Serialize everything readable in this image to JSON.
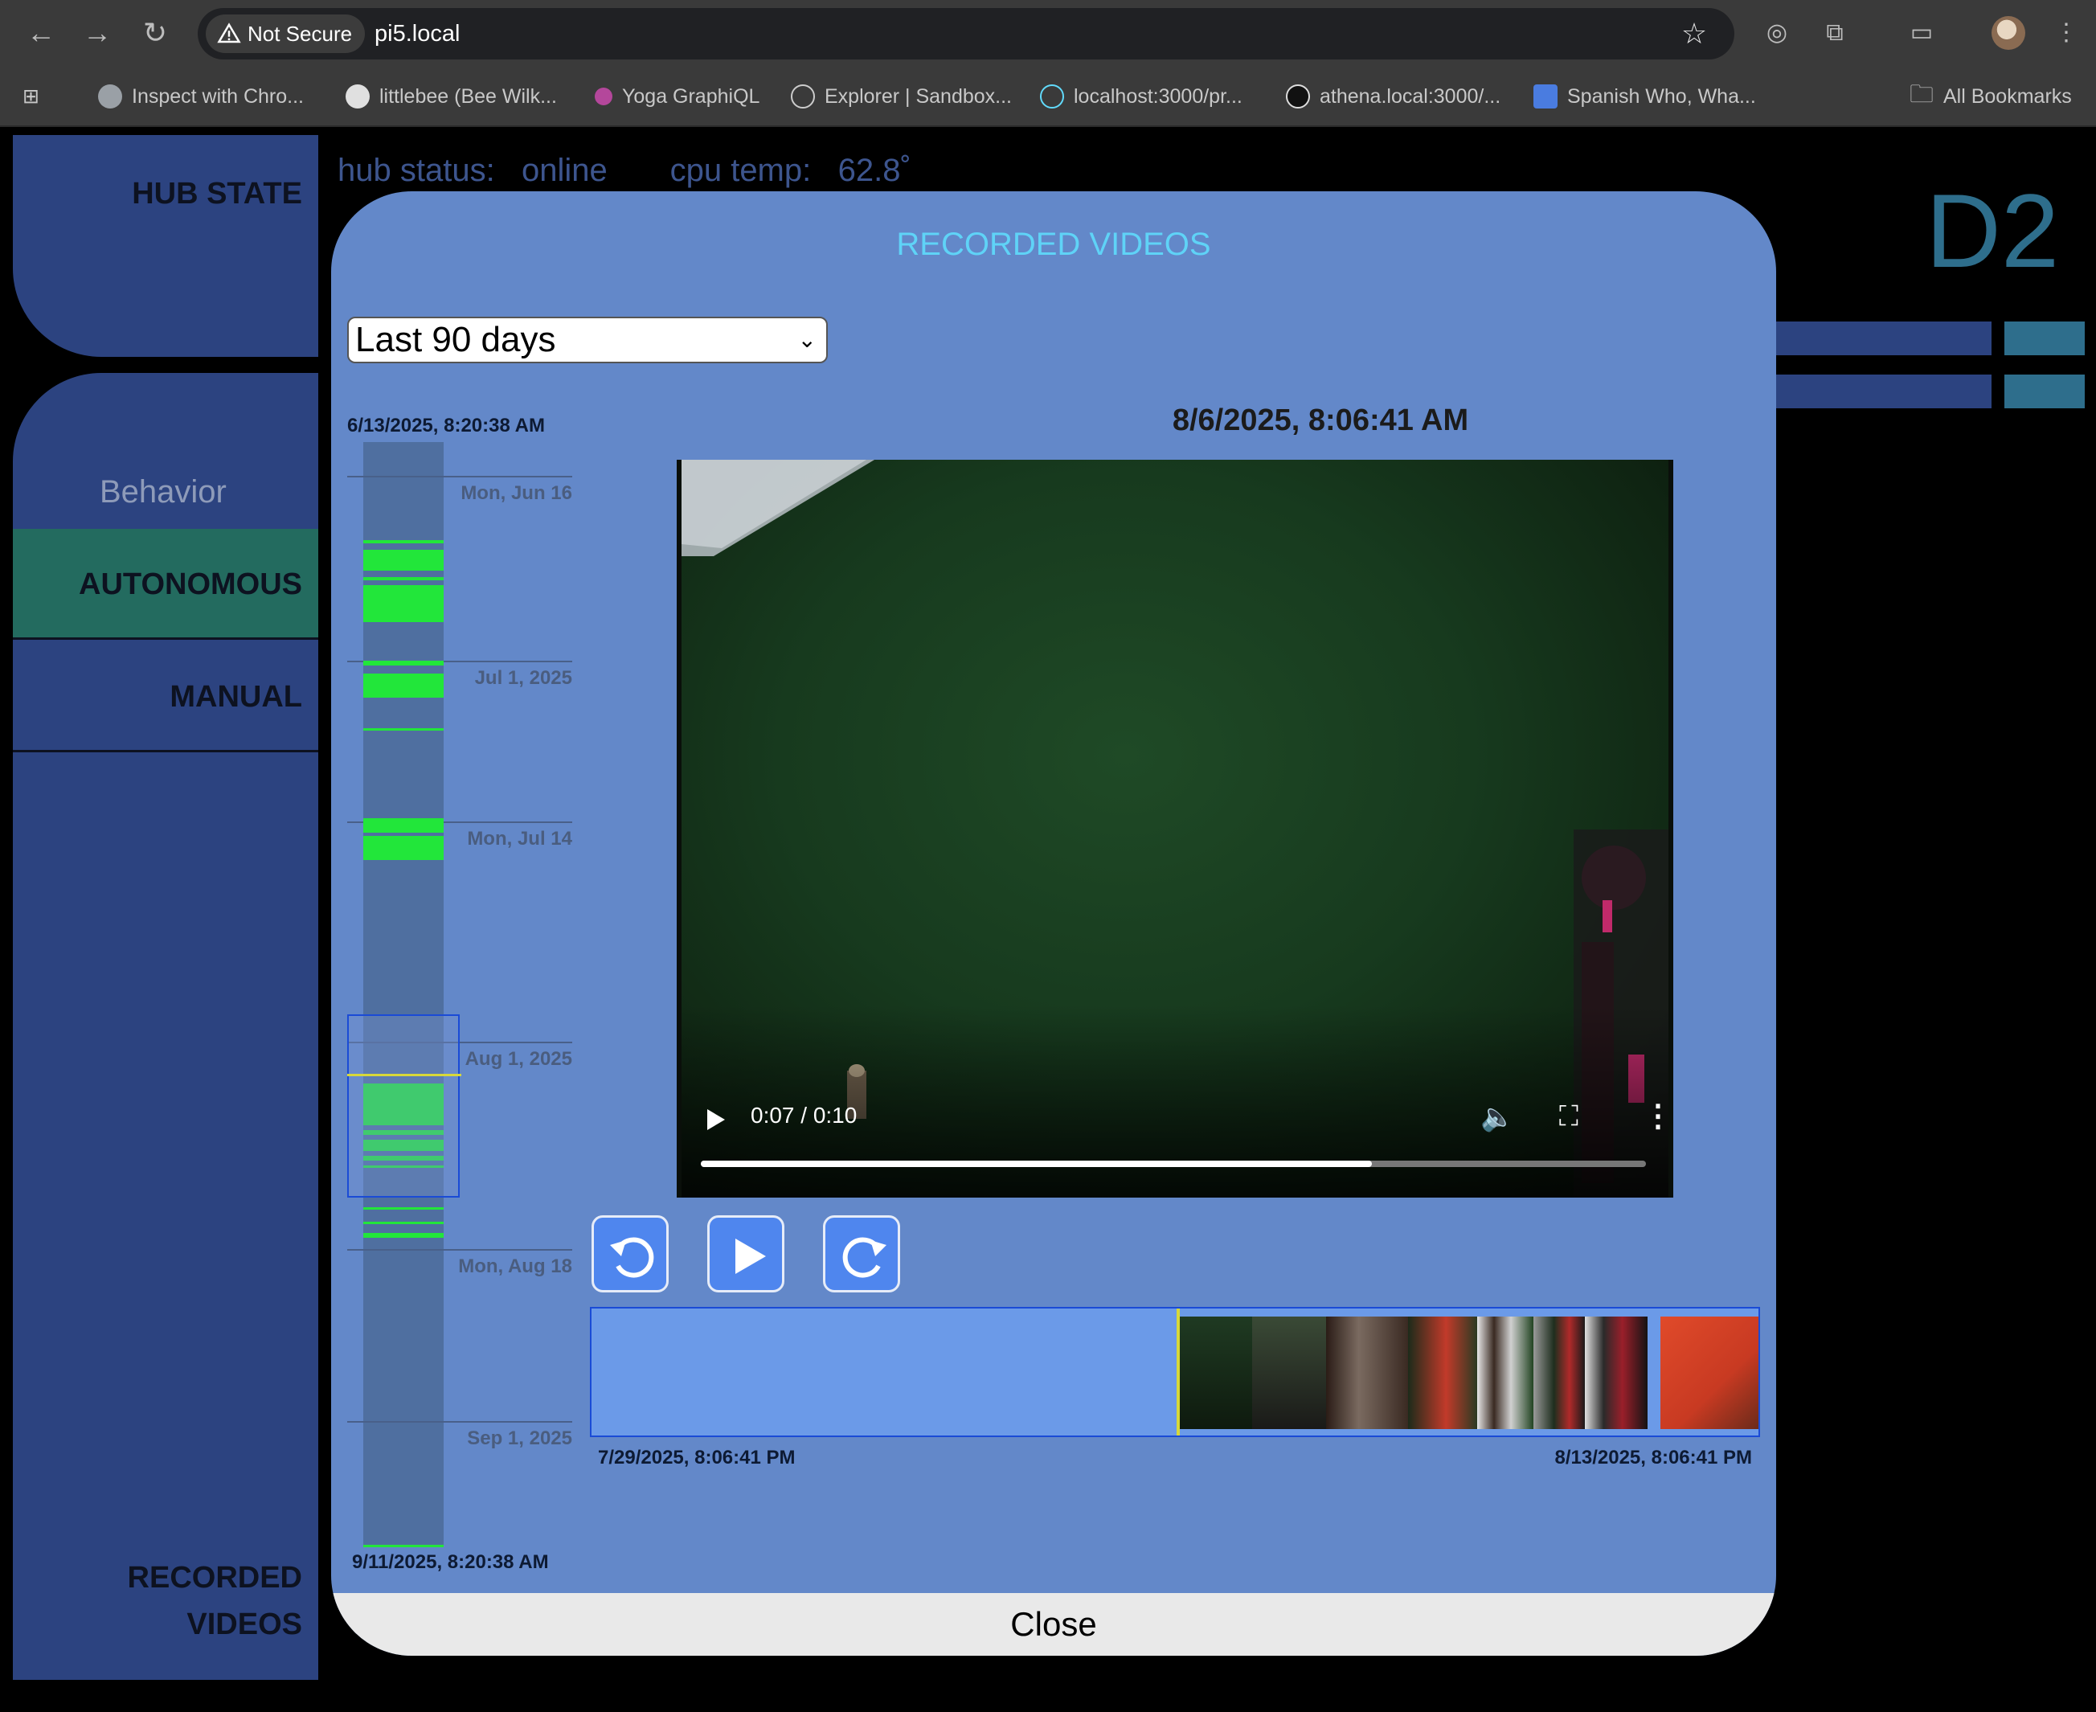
{
  "browser": {
    "security_label": "Not Secure",
    "url": "pi5.local",
    "bookmarks": [
      "Inspect with Chro...",
      "littlebee (Bee Wilk...",
      "Yoga GraphiQL",
      "Explorer | Sandbox...",
      "localhost:3000/pr...",
      "athena.local:3000/...",
      "Spanish Who, Wha..."
    ],
    "all_bookmarks": "All Bookmarks"
  },
  "app": {
    "hub_state": "HUB STATE",
    "hub_status_label": "hub status:",
    "hub_status_value": "online",
    "cpu_temp_label": "cpu temp:",
    "cpu_temp_value": "62.8˚",
    "robot_name": "D2",
    "behavior_label": "Behavior",
    "modes": [
      "AUTONOMOUS",
      "MANUAL"
    ],
    "selected_mode": "AUTONOMOUS",
    "recorded_videos_nav": [
      "RECORDED",
      "VIDEOS"
    ]
  },
  "modal": {
    "title": "RECORDED VIDEOS",
    "range_select": "Last 90 days",
    "timeline": {
      "start": "6/13/2025, 8:20:38 AM",
      "end": "9/11/2025, 8:20:38 AM",
      "ticks": [
        "Mon, Jun 16",
        "Jul 1, 2025",
        "Mon, Jul 14",
        "Aug 1, 2025",
        "Mon, Aug 18",
        "Sep 1, 2025"
      ]
    },
    "video_timestamp": "8/6/2025, 8:06:41 AM",
    "video_time": "0:07 / 0:10",
    "video_progress": 0.71,
    "strip_start": "7/29/2025, 8:06:41 PM",
    "strip_end": "8/13/2025, 8:06:41 PM",
    "close_label": "Close"
  },
  "colors": {
    "lcars_blue": "#2c4380",
    "autonomous_green": "#236b5f",
    "modal_bg": "#6388c9",
    "title_cyan": "#5fd3f7",
    "recording_green": "#22e63a"
  }
}
